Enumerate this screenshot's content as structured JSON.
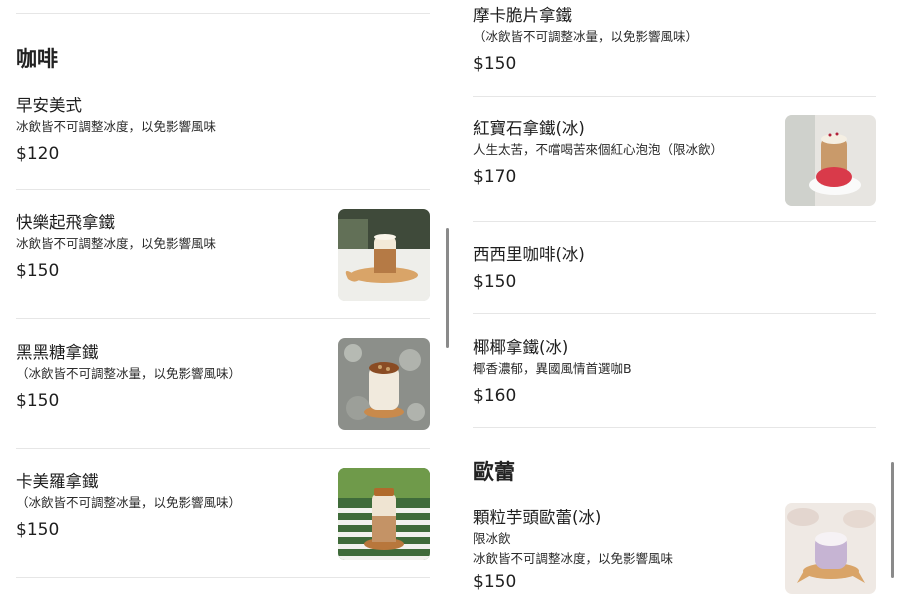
{
  "left": {
    "section_title": "咖啡",
    "items": [
      {
        "name": "早安美式",
        "desc": "冰飲皆不可調整冰度，以免影響風味",
        "price": "$120",
        "image": "none"
      },
      {
        "name": "快樂起飛拿鐵",
        "desc": "冰飲皆不可調整冰度，以免影響風味",
        "price": "$150",
        "image": "latte-with-airplane-photo"
      },
      {
        "name": "黑黑糖拿鐵",
        "desc": "（冰飲皆不可調整冰量，以免影響風味）",
        "price": "$150",
        "image": "brown-sugar-latte-photo"
      },
      {
        "name": "卡美羅拿鐵",
        "desc": "（冰飲皆不可調整冰量，以免影響風味）",
        "price": "$150",
        "image": "caramel-latte-photo"
      }
    ]
  },
  "right": {
    "items_top": [
      {
        "name": "摩卡脆片拿鐵",
        "desc": "（冰飲皆不可調整冰量，以免影響風味）",
        "price": "$150",
        "image": "none"
      },
      {
        "name": "紅寶石拿鐵(冰)",
        "desc": "人生太苦，不嚐喝苦來個紅心泡泡（限冰飲）",
        "price": "$170",
        "image": "ruby-latte-photo"
      },
      {
        "name": "西西里咖啡(冰)",
        "desc": "",
        "price": "$150",
        "image": "none"
      },
      {
        "name": "椰椰拿鐵(冰)",
        "desc": "椰香濃郁，異國風情首選咖B",
        "price": "$160",
        "image": "none"
      }
    ],
    "section_title": "歐蕾",
    "items_bottom": [
      {
        "name": "顆粒芋頭歐蕾(冰)",
        "desc": "限冰飲",
        "desc2": "冰飲皆不可調整冰度，以免影響風味",
        "price": "$150",
        "image": "taro-latte-photo"
      }
    ]
  }
}
